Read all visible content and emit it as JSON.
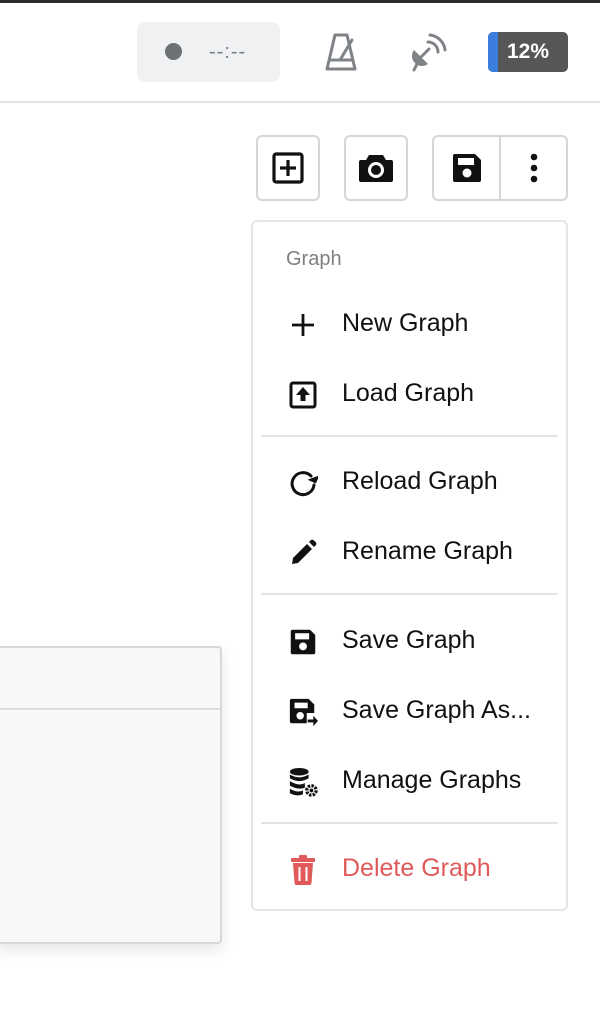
{
  "status_bar": {
    "timer_text": "--:--",
    "battery": {
      "percent": 12,
      "label": "12%",
      "fill_color": "#3b7ddd"
    },
    "icons": [
      "record-dot-icon",
      "metronome-icon",
      "satellite-icon"
    ]
  },
  "toolbar": {
    "buttons": [
      {
        "name": "add-node-button",
        "icon": "plus-square-icon"
      },
      {
        "name": "screenshot-button",
        "icon": "camera-icon"
      },
      {
        "name": "save-button",
        "icon": "floppy-disk-icon"
      },
      {
        "name": "more-menu-button",
        "icon": "vertical-ellipsis-icon"
      }
    ]
  },
  "menu": {
    "header": "Graph",
    "items": [
      {
        "label": "New Graph",
        "icon": "plus-icon"
      },
      {
        "label": "Load Graph",
        "icon": "upload-box-icon"
      },
      {
        "label": "Reload Graph",
        "icon": "reload-icon"
      },
      {
        "label": "Rename Graph",
        "icon": "pencil-icon"
      },
      {
        "label": "Save Graph",
        "icon": "floppy-disk-icon"
      },
      {
        "label": "Save Graph As...",
        "icon": "save-as-icon"
      },
      {
        "label": "Manage Graphs",
        "icon": "database-gear-icon"
      },
      {
        "label": "Delete Graph",
        "icon": "trash-icon",
        "color": "#e05a5a"
      }
    ]
  }
}
